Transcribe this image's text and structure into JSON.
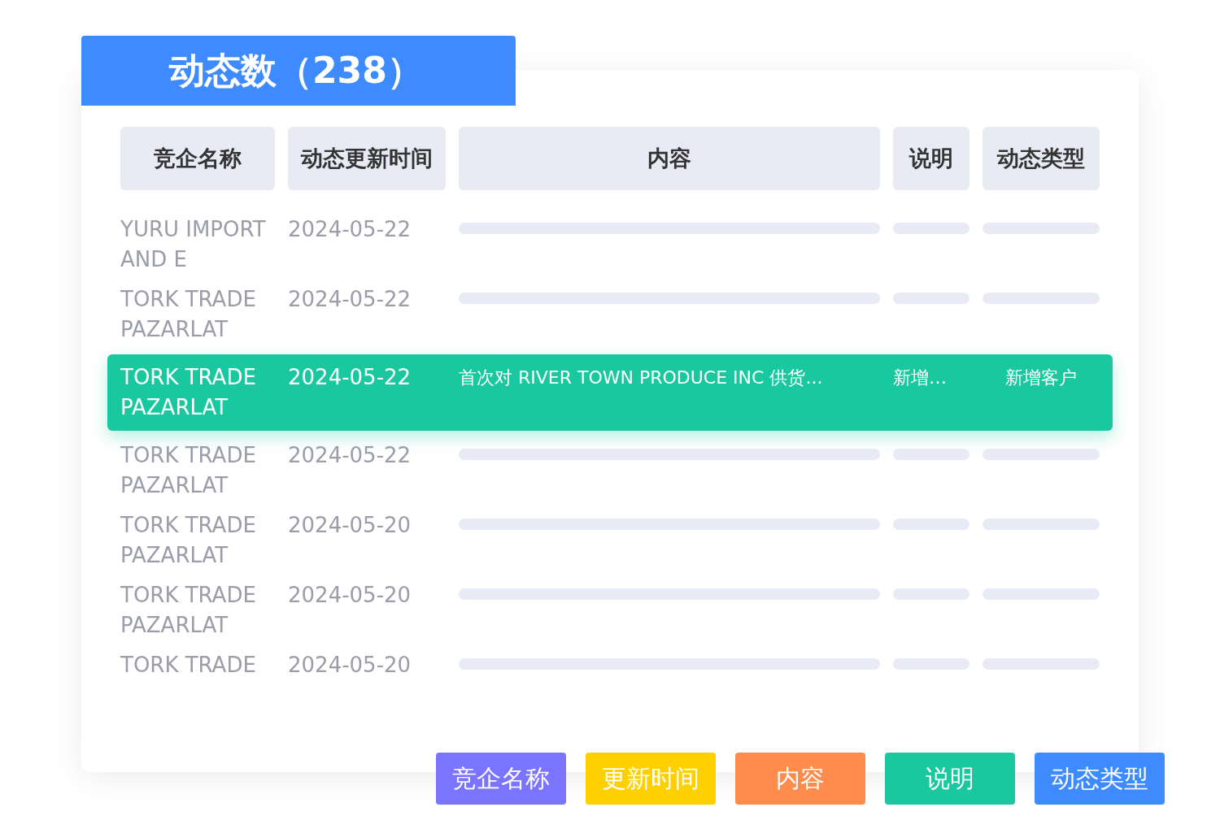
{
  "title": "动态数（238）",
  "columns": [
    "竞企名称",
    "动态更新时间",
    "内容",
    "说明",
    "动态类型"
  ],
  "rows": [
    {
      "name": "YURU IMPORT AND E",
      "date": "2024-05-22",
      "selected": false
    },
    {
      "name": "TORK TRADE PAZARLAT",
      "date": "2024-05-22",
      "selected": false
    },
    {
      "name": "TORK TRADE PAZARLAT",
      "date": "2024-05-22",
      "selected": true,
      "content": "首次对 RIVER TOWN PRODUCE INC 供货...",
      "note": "新增…",
      "type": "新增客户"
    },
    {
      "name": "TORK TRADE PAZARLAT",
      "date": "2024-05-22",
      "selected": false
    },
    {
      "name": "TORK TRADE PAZARLAT",
      "date": "2024-05-20",
      "selected": false
    },
    {
      "name": "TORK TRADE PAZARLAT",
      "date": "2024-05-20",
      "selected": false
    },
    {
      "name": "TORK TRADE",
      "date": "2024-05-20",
      "selected": false
    }
  ],
  "legend": [
    {
      "label": "竞企名称",
      "color": "#7b74ff"
    },
    {
      "label": "更新时间",
      "color": "#ffd000"
    },
    {
      "label": "内容",
      "color": "#ff8b4d"
    },
    {
      "label": "说明",
      "color": "#19c89f"
    },
    {
      "label": "动态类型",
      "color": "#3d8bff"
    }
  ]
}
